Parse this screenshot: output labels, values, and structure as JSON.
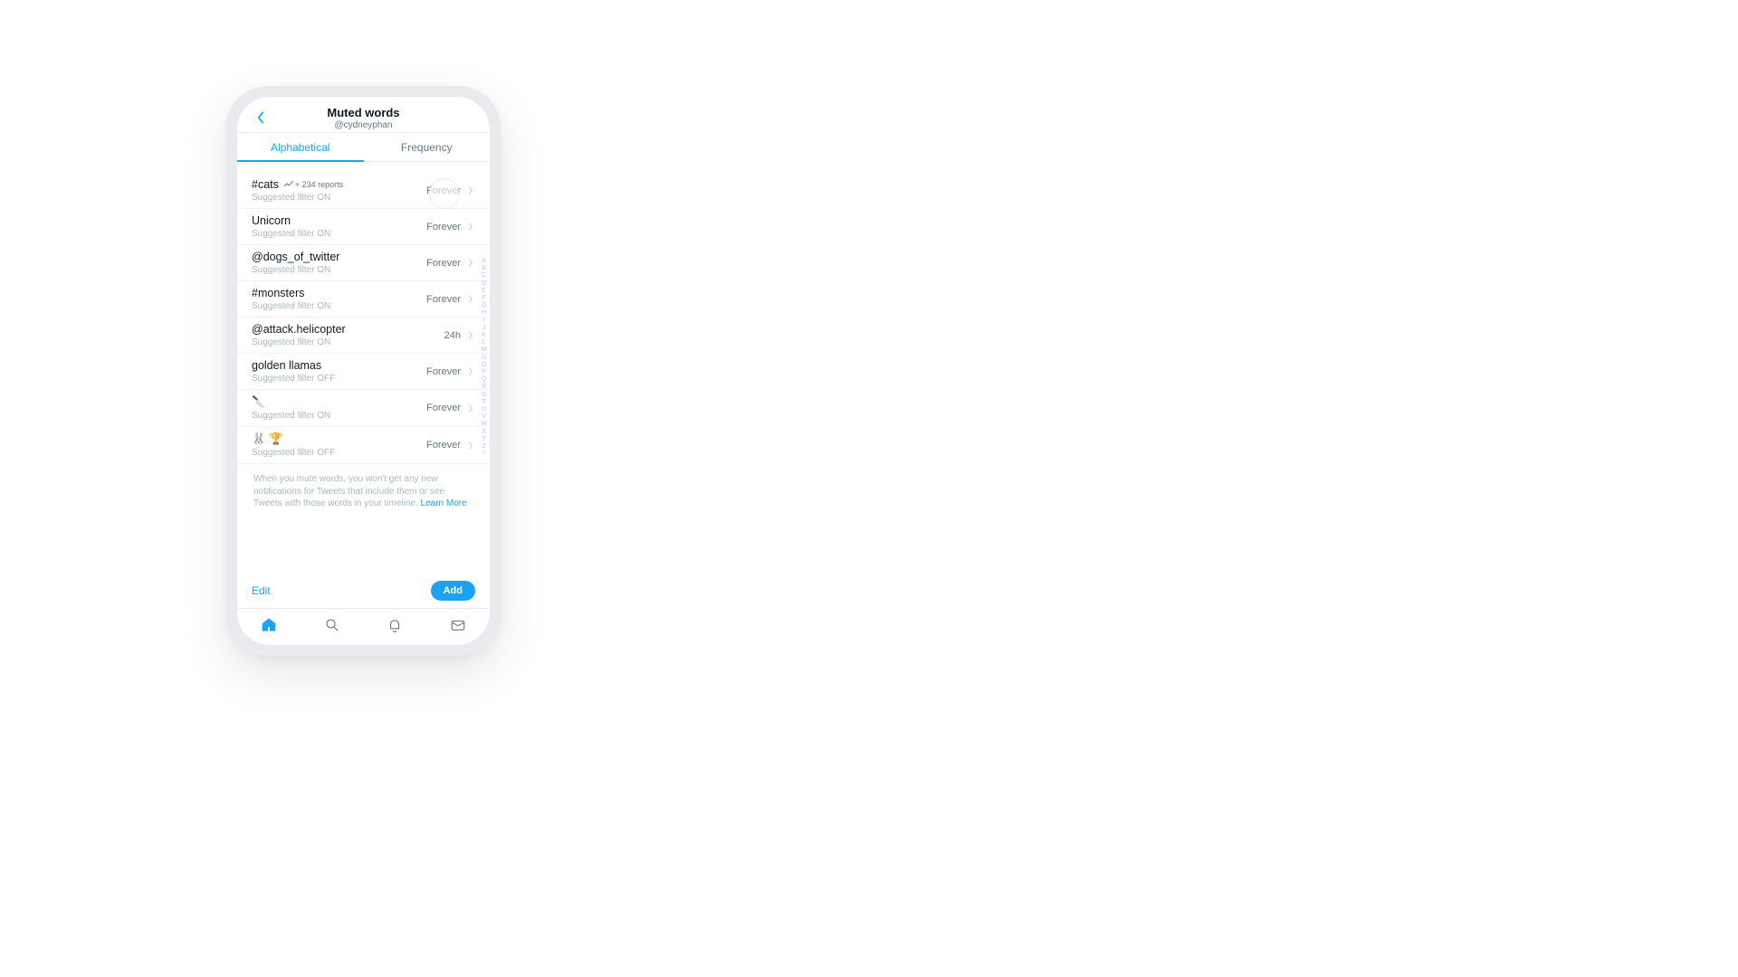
{
  "header": {
    "title": "Muted words",
    "subtitle": "@cydneyphan"
  },
  "tabs": {
    "alphabetical": "Alphabetical",
    "frequency": "Frequency"
  },
  "rows": [
    {
      "word": "#cats",
      "trend": "+ 234 reports",
      "sub": "Suggested filter ON",
      "duration": "Forever"
    },
    {
      "word": "Unicorn",
      "sub": "Suggested filter ON",
      "duration": "Forever"
    },
    {
      "word": "@dogs_of_twitter",
      "sub": "Suggested filter ON",
      "duration": "Forever"
    },
    {
      "word": "#monsters",
      "sub": "Suggested filter ON",
      "duration": "Forever"
    },
    {
      "word": "@attack.helicopter",
      "sub": "Suggested filter ON",
      "duration": "24h"
    },
    {
      "word": "golden llamas",
      "sub": "Suggested filter OFF",
      "duration": "Forever"
    },
    {
      "word": "🔪",
      "sub": "Suggested filter ON",
      "duration": "Forever"
    },
    {
      "word": "🐰 🏆",
      "sub": "Suggested filter OFF",
      "duration": "Forever"
    }
  ],
  "alpha_index": [
    "A",
    "B",
    "C",
    "D",
    "E",
    "F",
    "G",
    "H",
    "I",
    "J",
    "K",
    "L",
    "M",
    "N",
    "O",
    "P",
    "Q",
    "R",
    "S",
    "T",
    "U",
    "V",
    "W",
    "X",
    "Y",
    "Z",
    "*"
  ],
  "info": {
    "text": "When you mute words, you won't get any new notifications for Tweets that include them or see Tweets with those words in your timeline.",
    "learn_more": "Learn More"
  },
  "actions": {
    "edit": "Edit",
    "add": "Add"
  }
}
